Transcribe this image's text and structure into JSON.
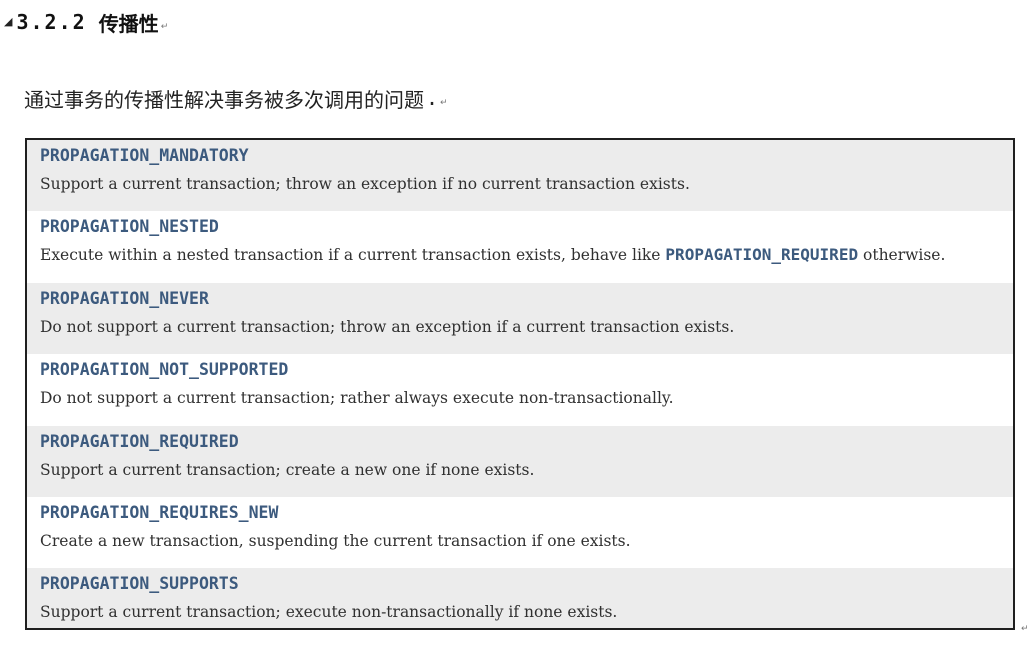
{
  "heading": {
    "number": "3.2.2",
    "title": "传播性"
  },
  "intro": {
    "text": "通过事务的传播性解决事务被多次调用的问题",
    "period": "."
  },
  "paragraph_mark": "↵",
  "rows": [
    {
      "constant": "PROPAGATION_MANDATORY",
      "description": "Support a current transaction; throw an exception if no current transaction exists."
    },
    {
      "constant": "PROPAGATION_NESTED",
      "description_before": "Execute within a nested transaction if a current transaction exists, behave like ",
      "description_const": "PROPAGATION_REQUIRED",
      "description_after": " otherwise."
    },
    {
      "constant": "PROPAGATION_NEVER",
      "description": "Do not support a current transaction; throw an exception if a current transaction exists."
    },
    {
      "constant": "PROPAGATION_NOT_SUPPORTED",
      "description": "Do not support a current transaction; rather always execute non-transactionally."
    },
    {
      "constant": "PROPAGATION_REQUIRED",
      "description": "Support a current transaction; create a new one if none exists."
    },
    {
      "constant": "PROPAGATION_REQUIRES_NEW",
      "description": "Create a new transaction, suspending the current transaction if one exists."
    },
    {
      "constant": "PROPAGATION_SUPPORTS",
      "description": "Support a current transaction; execute non-transactionally if none exists."
    }
  ],
  "colors": {
    "constant_text": "#3c5a7e",
    "alt_row_background": "#ececec",
    "table_border": "#1f1f1f"
  }
}
